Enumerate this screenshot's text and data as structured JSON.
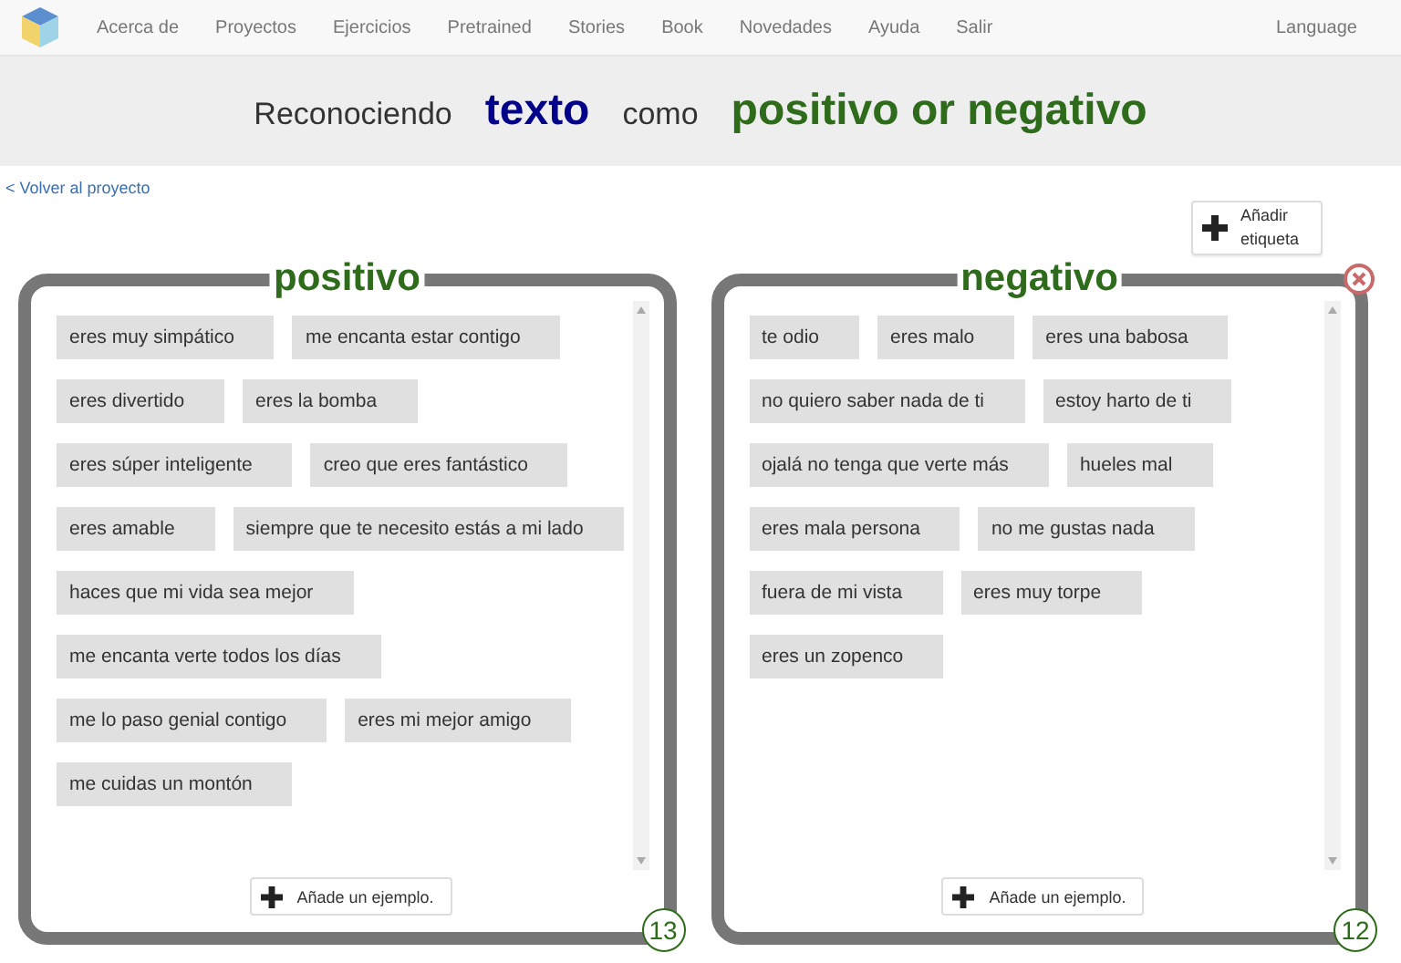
{
  "nav": {
    "items": [
      "Acerca de",
      "Proyectos",
      "Ejercicios",
      "Pretrained",
      "Stories",
      "Book",
      "Novedades",
      "Ayuda",
      "Salir"
    ],
    "language": "Language"
  },
  "heading": {
    "parts": [
      {
        "text": "Reconociendo",
        "kind": "plain"
      },
      {
        "text": "texto",
        "kind": "type"
      },
      {
        "text": "como",
        "kind": "plain"
      },
      {
        "text": "positivo or negativo",
        "kind": "labels"
      }
    ]
  },
  "back_link": "< Volver al proyecto",
  "add_label_button": {
    "line1": "Añadir",
    "line2": "etiqueta"
  },
  "buckets": [
    {
      "label": "positivo",
      "deletable": false,
      "count": "13",
      "add_button": "Añade un ejemplo.",
      "examples": [
        "eres muy simpático",
        "me encanta estar contigo",
        "eres divertido",
        "eres la bomba",
        "eres súper inteligente",
        "creo que eres fantástico",
        "eres amable",
        "siempre que te necesito estás a mi lado",
        "haces que mi vida sea mejor",
        "me encanta verte todos los días",
        "me lo paso genial contigo",
        "eres mi mejor amigo",
        "me cuidas un montón"
      ]
    },
    {
      "label": "negativo",
      "deletable": true,
      "count": "12",
      "add_button": "Añade un ejemplo.",
      "examples": [
        "te odio",
        "eres malo",
        "eres una babosa",
        "no quiero saber nada de ti",
        "estoy harto de ti",
        "ojalá no tenga que verte más",
        "hueles mal",
        "eres mala persona",
        "no me gustas nada",
        "fuera de mi vista",
        "eres muy torpe",
        "eres un zopenco"
      ]
    }
  ]
}
